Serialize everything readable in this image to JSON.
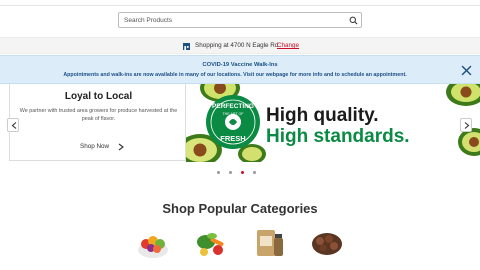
{
  "search": {
    "placeholder": "Search Products",
    "icon": "search-icon"
  },
  "store_bar": {
    "text": "Shopping at 4700 N Eagle Rd",
    "change_label": "Change",
    "icon": "store-icon"
  },
  "covid_banner": {
    "title": "COVID-19 Vaccine Walk-Ins",
    "body": "Appointments and walk-ins are now available in many of our locations. Visit our webpage for more info and to schedule an appointment.",
    "close_icon": "close-icon"
  },
  "hero": {
    "promo_title": "Loyal to Local",
    "promo_body": "We partner with trusted area growers for produce harvested at the peak of flavor.",
    "shop_now": "Shop Now",
    "banner_line1": "High quality.",
    "banner_line2": "High standards.",
    "badge_top": "PERFECTING",
    "badge_mid": "THE ART OF",
    "badge_bottom": "FRESH",
    "slide_count": 4,
    "active_slide": 3
  },
  "categories_section": {
    "title": "Shop Popular Categories",
    "items": [
      {
        "icon": "fruit-bowl-icon"
      },
      {
        "icon": "vegetables-icon"
      },
      {
        "icon": "pantry-jar-icon"
      },
      {
        "icon": "meat-icon"
      }
    ]
  },
  "colors": {
    "brand_red": "#c8102e",
    "banner_green": "#0b8a44",
    "notice_blue": "#1d4f86"
  }
}
